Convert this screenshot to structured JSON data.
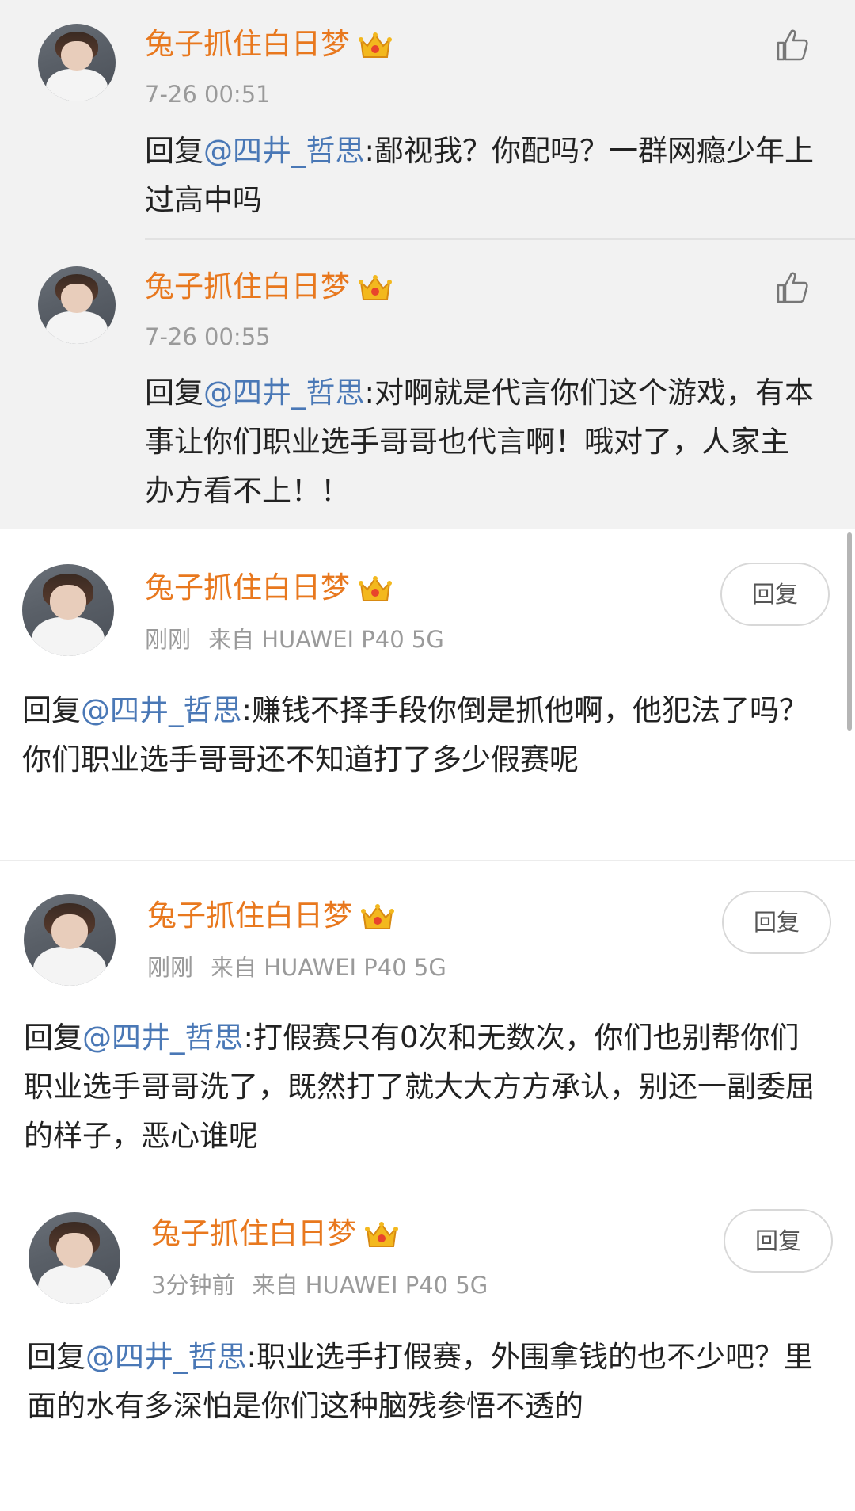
{
  "comments": [
    {
      "username": "兔子抓住白日梦",
      "time": "7-26 00:51",
      "source": "",
      "reply_prefix": "回复",
      "mention": "@四井_哲思",
      "text": ":鄙视我？你配吗？一群网瘾少年上过高中吗",
      "action": "like-icon"
    },
    {
      "username": "兔子抓住白日梦",
      "time": "7-26 00:55",
      "source": "",
      "reply_prefix": "回复",
      "mention": "@四井_哲思",
      "text": ":对啊就是代言你们这个游戏，有本事让你们职业选手哥哥也代言啊！哦对了，人家主办方看不上！！",
      "action": "like-icon"
    },
    {
      "username": "兔子抓住白日梦",
      "time": "刚刚",
      "source": "来自 HUAWEI P40 5G",
      "reply_prefix": "回复",
      "mention": "@四井_哲思",
      "text": ":赚钱不择手段你倒是抓他啊，他犯法了吗？你们职业选手哥哥还不知道打了多少假赛呢",
      "action_label": "回复"
    },
    {
      "username": "兔子抓住白日梦",
      "time": "刚刚",
      "source": "来自 HUAWEI P40 5G",
      "reply_prefix": "回复",
      "mention": "@四井_哲思",
      "text": ":打假赛只有0次和无数次，你们也别帮你们职业选手哥哥洗了，既然打了就大大方方承认，别还一副委屈的样子，恶心谁呢",
      "action_label": "回复"
    },
    {
      "username": "兔子抓住白日梦",
      "time": "3分钟前",
      "source": "来自 HUAWEI P40 5G",
      "reply_prefix": "回复",
      "mention": "@四井_哲思",
      "text": ":职业选手打假赛，外围拿钱的也不少吧？里面的水有多深怕是你们这种脑残参悟不透的",
      "action_label": "回复"
    }
  ],
  "colors": {
    "username": "#e8781e",
    "mention": "#4a78b6",
    "meta": "#9a9a9a",
    "gray_bg": "#f2f2f2"
  }
}
